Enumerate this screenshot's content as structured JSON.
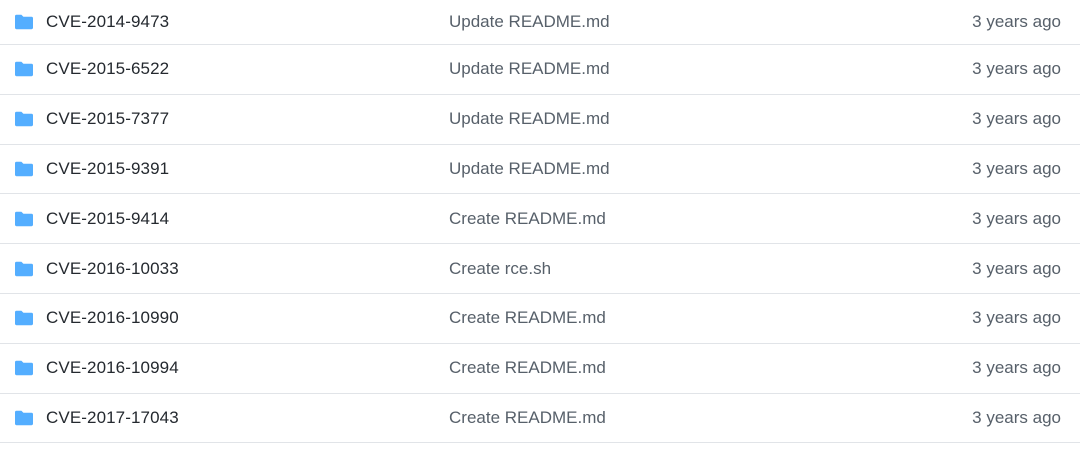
{
  "file_list": {
    "rows": [
      {
        "name": "CVE-2014-9473",
        "commit_message": "Update README.md",
        "age": "3 years ago",
        "icon": "folder-icon"
      },
      {
        "name": "CVE-2015-6522",
        "commit_message": "Update README.md",
        "age": "3 years ago",
        "icon": "folder-icon"
      },
      {
        "name": "CVE-2015-7377",
        "commit_message": "Update README.md",
        "age": "3 years ago",
        "icon": "folder-icon"
      },
      {
        "name": "CVE-2015-9391",
        "commit_message": "Update README.md",
        "age": "3 years ago",
        "icon": "folder-icon"
      },
      {
        "name": "CVE-2015-9414",
        "commit_message": "Create README.md",
        "age": "3 years ago",
        "icon": "folder-icon"
      },
      {
        "name": "CVE-2016-10033",
        "commit_message": "Create rce.sh",
        "age": "3 years ago",
        "icon": "folder-icon"
      },
      {
        "name": "CVE-2016-10990",
        "commit_message": "Create README.md",
        "age": "3 years ago",
        "icon": "folder-icon"
      },
      {
        "name": "CVE-2016-10994",
        "commit_message": "Create README.md",
        "age": "3 years ago",
        "icon": "folder-icon"
      },
      {
        "name": "CVE-2017-17043",
        "commit_message": "Create README.md",
        "age": "3 years ago",
        "icon": "folder-icon"
      }
    ]
  },
  "colors": {
    "folder_icon": "#54aeff",
    "name_text": "#24292f",
    "muted_text": "#57606a",
    "divider": "#e1e4e8"
  }
}
